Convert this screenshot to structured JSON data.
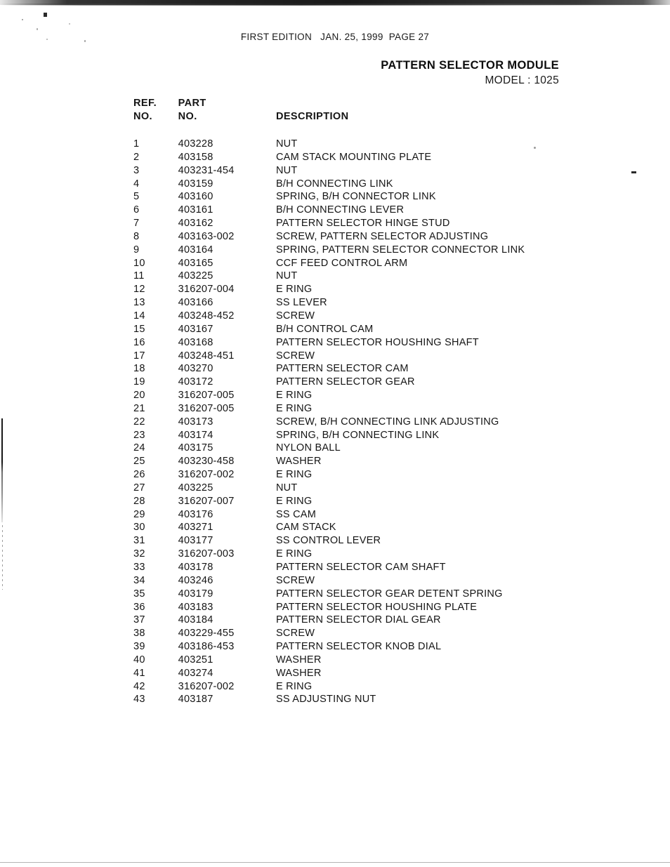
{
  "header": {
    "edition_line": "FIRST EDITION   JAN. 25, 1999  PAGE 27",
    "title": "PATTERN SELECTOR MODULE",
    "model": "MODEL : 1025"
  },
  "table": {
    "columns": {
      "ref_no": "REF.\nNO.",
      "part_no": "PART\nNO.",
      "description": "DESCRIPTION"
    },
    "rows": [
      {
        "ref": "1",
        "part": "403228",
        "desc": "NUT"
      },
      {
        "ref": "2",
        "part": "403158",
        "desc": "CAM STACK MOUNTING PLATE"
      },
      {
        "ref": "3",
        "part": "403231-454",
        "desc": "NUT"
      },
      {
        "ref": "4",
        "part": "403159",
        "desc": "B/H CONNECTING LINK"
      },
      {
        "ref": "5",
        "part": "403160",
        "desc": "SPRING, B/H CONNECTOR LINK"
      },
      {
        "ref": "6",
        "part": "403161",
        "desc": "B/H CONNECTING LEVER"
      },
      {
        "ref": "7",
        "part": "403162",
        "desc": "PATTERN SELECTOR HINGE STUD"
      },
      {
        "ref": "8",
        "part": "403163-002",
        "desc": "SCREW, PATTERN SELECTOR ADJUSTING"
      },
      {
        "ref": "9",
        "part": "403164",
        "desc": "SPRING, PATTERN SELECTOR CONNECTOR LINK"
      },
      {
        "ref": "10",
        "part": "403165",
        "desc": "CCF FEED CONTROL ARM"
      },
      {
        "ref": "11",
        "part": "403225",
        "desc": "NUT"
      },
      {
        "ref": "12",
        "part": "316207-004",
        "desc": "E RING"
      },
      {
        "ref": "13",
        "part": "403166",
        "desc": "SS LEVER"
      },
      {
        "ref": "14",
        "part": "403248-452",
        "desc": "SCREW"
      },
      {
        "ref": "15",
        "part": "403167",
        "desc": "B/H CONTROL CAM"
      },
      {
        "ref": "16",
        "part": "403168",
        "desc": "PATTERN SELECTOR HOUSHING SHAFT"
      },
      {
        "ref": "17",
        "part": "403248-451",
        "desc": "SCREW"
      },
      {
        "ref": "18",
        "part": "403270",
        "desc": "PATTERN SELECTOR CAM"
      },
      {
        "ref": "19",
        "part": "403172",
        "desc": "PATTERN SELECTOR GEAR"
      },
      {
        "ref": "20",
        "part": "316207-005",
        "desc": "E RING"
      },
      {
        "ref": "21",
        "part": "316207-005",
        "desc": "E RING"
      },
      {
        "ref": "22",
        "part": "403173",
        "desc": "SCREW, B/H CONNECTING LINK ADJUSTING"
      },
      {
        "ref": "23",
        "part": "403174",
        "desc": "SPRING, B/H CONNECTING LINK"
      },
      {
        "ref": "24",
        "part": "403175",
        "desc": "NYLON BALL"
      },
      {
        "ref": "25",
        "part": "403230-458",
        "desc": "WASHER"
      },
      {
        "ref": "26",
        "part": "316207-002",
        "desc": "E RING"
      },
      {
        "ref": "27",
        "part": "403225",
        "desc": "NUT"
      },
      {
        "ref": "28",
        "part": "316207-007",
        "desc": "E RING"
      },
      {
        "ref": "29",
        "part": "403176",
        "desc": "SS CAM"
      },
      {
        "ref": "30",
        "part": "403271",
        "desc": "CAM STACK"
      },
      {
        "ref": "31",
        "part": "403177",
        "desc": "SS CONTROL LEVER"
      },
      {
        "ref": "32",
        "part": "316207-003",
        "desc": "E RING"
      },
      {
        "ref": "33",
        "part": "403178",
        "desc": "PATTERN SELECTOR CAM SHAFT"
      },
      {
        "ref": "34",
        "part": "403246",
        "desc": "SCREW"
      },
      {
        "ref": "35",
        "part": "403179",
        "desc": "PATTERN SELECTOR GEAR DETENT SPRING"
      },
      {
        "ref": "36",
        "part": "403183",
        "desc": "PATTERN SELECTOR HOUSHING PLATE"
      },
      {
        "ref": "37",
        "part": "403184",
        "desc": "PATTERN SELECTOR DIAL GEAR"
      },
      {
        "ref": "38",
        "part": "403229-455",
        "desc": "SCREW"
      },
      {
        "ref": "39",
        "part": "403186-453",
        "desc": "PATTERN SELECTOR KNOB DIAL"
      },
      {
        "ref": "40",
        "part": "403251",
        "desc": "WASHER"
      },
      {
        "ref": "41",
        "part": "403274",
        "desc": "WASHER"
      },
      {
        "ref": "42",
        "part": "316207-002",
        "desc": "E RING"
      },
      {
        "ref": "43",
        "part": "403187",
        "desc": "SS ADJUSTING NUT"
      }
    ]
  }
}
